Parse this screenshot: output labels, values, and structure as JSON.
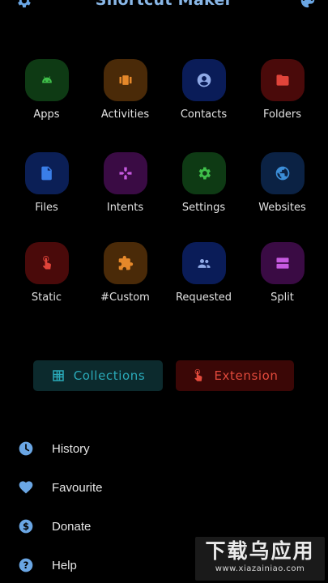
{
  "header": {
    "title": "Shortcut Maker",
    "left_icon": "settings-gear-icon",
    "right_icon": "palette-icon"
  },
  "grid": [
    {
      "label": "Apps",
      "icon": "android-icon",
      "bg": "#0e3a14",
      "fg": "#3fbf4a"
    },
    {
      "label": "Activities",
      "icon": "activities-icon",
      "bg": "#4a2a08",
      "fg": "#e5882a"
    },
    {
      "label": "Contacts",
      "icon": "contact-icon",
      "bg": "#0a1c58",
      "fg": "#8fa9e6"
    },
    {
      "label": "Folders",
      "icon": "folder-icon",
      "bg": "#4a0a0a",
      "fg": "#e0443a"
    },
    {
      "label": "Files",
      "icon": "file-icon",
      "bg": "#0b1f56",
      "fg": "#3a7ee8"
    },
    {
      "label": "Intents",
      "icon": "gamepad-icon",
      "bg": "#3a0b44",
      "fg": "#c65ae0"
    },
    {
      "label": "Settings",
      "icon": "gear-icon",
      "bg": "#0e3a14",
      "fg": "#3fbf4a"
    },
    {
      "label": "Websites",
      "icon": "globe-icon",
      "bg": "#0b2244",
      "fg": "#3c8ed8"
    },
    {
      "label": "Static",
      "icon": "touch-icon",
      "bg": "#4a0a0a",
      "fg": "#e0443a"
    },
    {
      "label": "#Custom",
      "icon": "puzzle-icon",
      "bg": "#4a2a08",
      "fg": "#e5882a"
    },
    {
      "label": "Requested",
      "icon": "people-icon",
      "bg": "#0a1c58",
      "fg": "#8fa9e6"
    },
    {
      "label": "Split",
      "icon": "split-icon",
      "bg": "#3a0b44",
      "fg": "#c65ae0"
    }
  ],
  "buttons": {
    "collections": {
      "label": "Collections",
      "icon": "grid-icon"
    },
    "extension": {
      "label": "Extension",
      "icon": "touch-icon"
    }
  },
  "menu": [
    {
      "label": "History",
      "icon": "clock-icon"
    },
    {
      "label": "Favourite",
      "icon": "heart-icon"
    },
    {
      "label": "Donate",
      "icon": "dollar-icon"
    },
    {
      "label": "Help",
      "icon": "help-icon"
    }
  ],
  "watermark": {
    "big": "下载乌应用",
    "small": "www.xiazainiao.com"
  },
  "colors": {
    "accent": "#6aa6e4",
    "background": "#000000"
  }
}
